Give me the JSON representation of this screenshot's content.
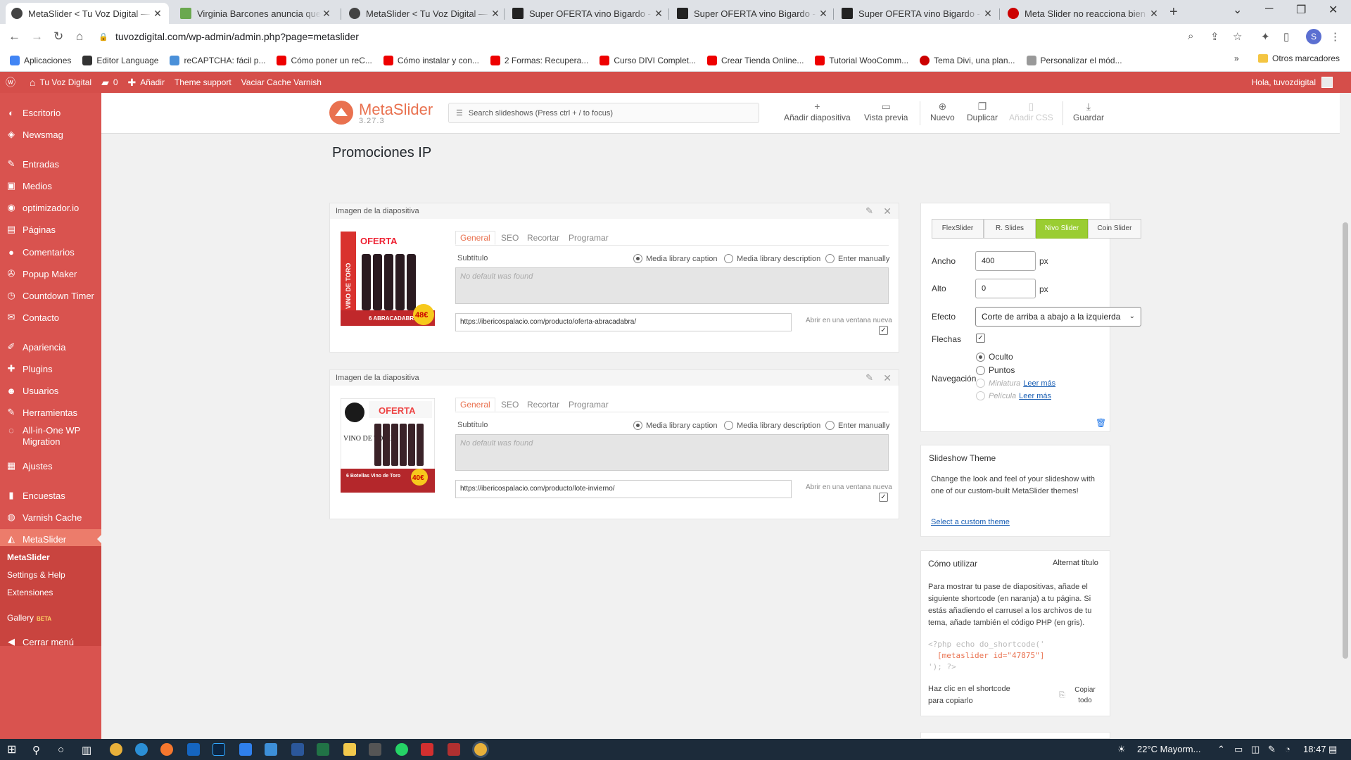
{
  "browser": {
    "tabs": [
      {
        "title": "MetaSlider < Tu Voz Digital — W",
        "fav": "#444"
      },
      {
        "title": "Virginia Barcones anuncia que la",
        "fav": "#6aa84f"
      },
      {
        "title": "MetaSlider < Tu Voz Digital — W",
        "fav": "#444"
      },
      {
        "title": "Super OFERTA vino Bigardo - Ib",
        "fav": "#222"
      },
      {
        "title": "Super OFERTA vino Bigardo - Ib",
        "fav": "#222"
      },
      {
        "title": "Super OFERTA vino Bigardo - Ib",
        "fav": "#222"
      },
      {
        "title": "Meta Slider no reacciona bien a",
        "fav": "#c00"
      }
    ],
    "new_tab": "+",
    "url": "tuvozdigital.com/wp-admin/admin.php?page=metaslider",
    "profile": "S",
    "bookmarks": [
      {
        "label": "Aplicaciones",
        "color": "#4285f4"
      },
      {
        "label": "Editor Language",
        "color": "#333"
      },
      {
        "label": "reCAPTCHA: fácil p...",
        "color": "#4a90d9"
      },
      {
        "label": "Cómo poner un reC...",
        "color": "#e00"
      },
      {
        "label": "Cómo instalar y con...",
        "color": "#e00"
      },
      {
        "label": "2 Formas: Recupera...",
        "color": "#e00"
      },
      {
        "label": "Curso DIVI Complet...",
        "color": "#e00"
      },
      {
        "label": "Crear Tienda Online...",
        "color": "#e00"
      },
      {
        "label": "Tutorial WooComm...",
        "color": "#e00"
      },
      {
        "label": "Tema Divi, una plan...",
        "color": "#c00"
      },
      {
        "label": "Personalizar el mód...",
        "color": "#999"
      }
    ],
    "bookmarks_more": "»",
    "other_bookmarks": "Otros marcadores"
  },
  "adminbar": {
    "site": "Tu Voz Digital",
    "comments": "0",
    "add": "Añadir",
    "theme_support": "Theme support",
    "varnish": "Vaciar Cache Varnish",
    "greeting": "Hola, tuvozdigital"
  },
  "sidebar": {
    "items": [
      {
        "label": "Escritorio",
        "icon": "◐",
        "top": 0
      },
      {
        "label": "Newsmag",
        "icon": "◈",
        "top": 0
      },
      {
        "label": "Entradas",
        "icon": "✎",
        "top": 0
      },
      {
        "label": "Medios",
        "icon": "▣",
        "top": 0
      },
      {
        "label": "optimizador.io",
        "icon": "◉",
        "top": 0
      },
      {
        "label": "Páginas",
        "icon": "▤",
        "top": 0
      },
      {
        "label": "Comentarios",
        "icon": "●",
        "top": 0
      },
      {
        "label": "Popup Maker",
        "icon": "✇",
        "top": 0
      },
      {
        "label": "Countdown Timer",
        "icon": "◷",
        "top": 0
      },
      {
        "label": "Contacto",
        "icon": "✉",
        "top": 0
      },
      {
        "label": "Apariencia",
        "icon": "✐",
        "top": 0
      },
      {
        "label": "Plugins",
        "icon": "✚",
        "top": 0
      },
      {
        "label": "Usuarios",
        "icon": "☻",
        "top": 0
      },
      {
        "label": "Herramientas",
        "icon": "✎",
        "top": 0
      },
      {
        "label": "All-in-One WP Migration",
        "icon": "◌",
        "top": 0
      },
      {
        "label": "Ajustes",
        "icon": "▦",
        "top": 0
      },
      {
        "label": "Encuestas",
        "icon": "▮",
        "top": 0
      },
      {
        "label": "Varnish Cache",
        "icon": "◍",
        "top": 0
      },
      {
        "label": "MetaSlider",
        "icon": "◭",
        "top": 0
      }
    ],
    "sub": {
      "metaslider": "MetaSlider",
      "settings": "Settings & Help",
      "extensions": "Extensiones",
      "gallery": "Gallery",
      "beta": "BETA"
    },
    "collapse": "Cerrar menú"
  },
  "metaslider": {
    "name": "MetaSlider",
    "version": "3.27.3",
    "search_placeholder": "Search slideshows (Press ctrl + / to focus)",
    "actions": {
      "add_slide": "Añadir diapositiva",
      "preview": "Vista previa",
      "new": "Nuevo",
      "duplicate": "Duplicar",
      "add_css": "Añadir CSS",
      "save": "Guardar"
    },
    "title": "Promociones IP"
  },
  "slides": [
    {
      "header": "Imagen de la diapositiva",
      "tabs": [
        "General",
        "SEO",
        "Recortar",
        "Programar"
      ],
      "subtitle_label": "Subtítulo",
      "radios": [
        "Media library caption",
        "Media library description",
        "Enter manually"
      ],
      "caption_placeholder": "No default was found",
      "url": "https://ibericospalacio.com/producto/oferta-abracadabra/",
      "new_window": "Abrir en una ventana nueva",
      "thumb_side": "VINO DE TORO",
      "thumb_top": "OFERTA",
      "thumb_price": "48€",
      "thumb_bottom": "6 ABRACADABRA"
    },
    {
      "header": "Imagen de la diapositiva",
      "tabs": [
        "General",
        "SEO",
        "Recortar",
        "Programar"
      ],
      "subtitle_label": "Subtítulo",
      "radios": [
        "Media library caption",
        "Media library description",
        "Enter manually"
      ],
      "caption_placeholder": "No default was found",
      "url": "https://ibericospalacio.com/producto/lote-invierno/",
      "new_window": "Abrir en una ventana nueva",
      "thumb_side": "VINO DE TORO",
      "thumb_top": "OFERTA",
      "thumb_price": "40€",
      "thumb_bottom": "6 Botellas Vino de Toro"
    }
  ],
  "settings": {
    "types": [
      "FlexSlider",
      "R. Slides",
      "Nivo Slider",
      "Coin Slider"
    ],
    "width_label": "Ancho",
    "width": "400",
    "height_label": "Alto",
    "height": "0",
    "unit": "px",
    "effect_label": "Efecto",
    "effect": "Corte de arriba a abajo a la izquierda",
    "arrows_label": "Flechas",
    "nav_label": "Navegación",
    "nav_options": [
      "Oculto",
      "Puntos",
      "Miniatura",
      "Película"
    ],
    "read_more": "Leer más"
  },
  "theme": {
    "title": "Slideshow Theme",
    "text": "Change the look and feel of your slideshow with one of our custom-built MetaSlider themes!",
    "link": "Select a custom theme"
  },
  "usage": {
    "title": "Cómo utilizar",
    "alt": "Alternat título",
    "text": "Para mostrar tu pase de diapositivas, añade el siguiente shortcode (en naranja) a tu página. Si estás añadiendo el carrusel a los archivos de tu tema, añade también el código PHP (en gris).",
    "code1": "<?php echo do_shortcode('",
    "code2": "[metaslider id=\"47875\"]",
    "code3": "'); ?>",
    "copy_hint": "Haz clic en el shortcode para copiarlo",
    "copy_all": "Copiar todo"
  },
  "taskbar": {
    "weather": "22°C  Mayorm...",
    "time": "18:47"
  }
}
